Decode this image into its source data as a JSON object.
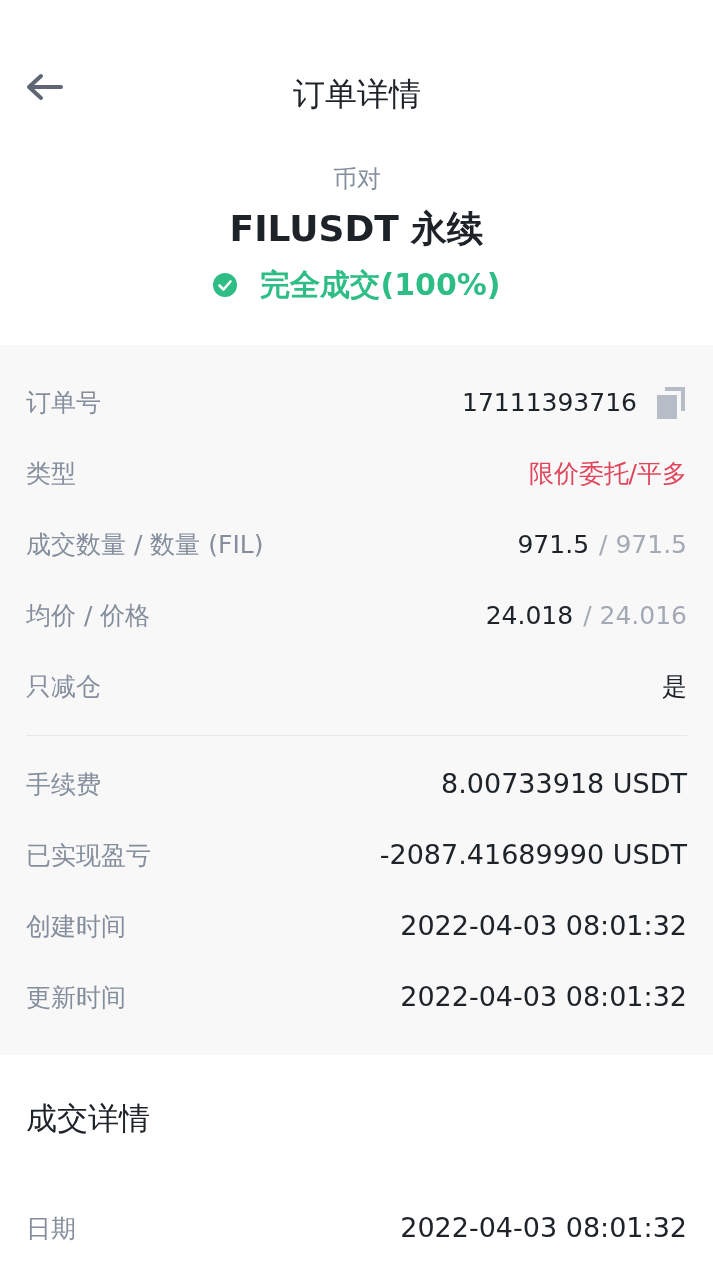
{
  "header": {
    "title": "订单详情"
  },
  "summary": {
    "pair_label": "币对",
    "symbol": "FILUSDT 永续",
    "status": {
      "text": "完全成交(100%)",
      "kind": "filled"
    }
  },
  "detail_groups": [
    [
      {
        "label": "订单号",
        "value": "17111393716",
        "copyable": true,
        "danger": false
      },
      {
        "label": "类型",
        "value": "限价委托/平多",
        "danger": true
      },
      {
        "label": "成交数量 / 数量 (FIL)",
        "value": "971.5",
        "secondary": "/ 971.5",
        "danger": false
      },
      {
        "label": "均价 / 价格",
        "value": "24.018",
        "secondary": "/ 24.016",
        "danger": false
      },
      {
        "label": "只减仓",
        "value": "是",
        "danger": false
      }
    ],
    [
      {
        "label": "手续费",
        "value": "8.00733918 USDT",
        "danger": false
      },
      {
        "label": "已实现盈亏",
        "value": "-2087.41689990 USDT",
        "danger": false
      },
      {
        "label": "创建时间",
        "value": "2022-04-03 08:01:32",
        "danger": false
      },
      {
        "label": "更新时间",
        "value": "2022-04-03 08:01:32",
        "danger": false
      }
    ]
  ],
  "fills": {
    "title": "成交详情",
    "rows": [
      {
        "label": "日期",
        "value": "2022-04-03 08:01:32"
      }
    ]
  }
}
